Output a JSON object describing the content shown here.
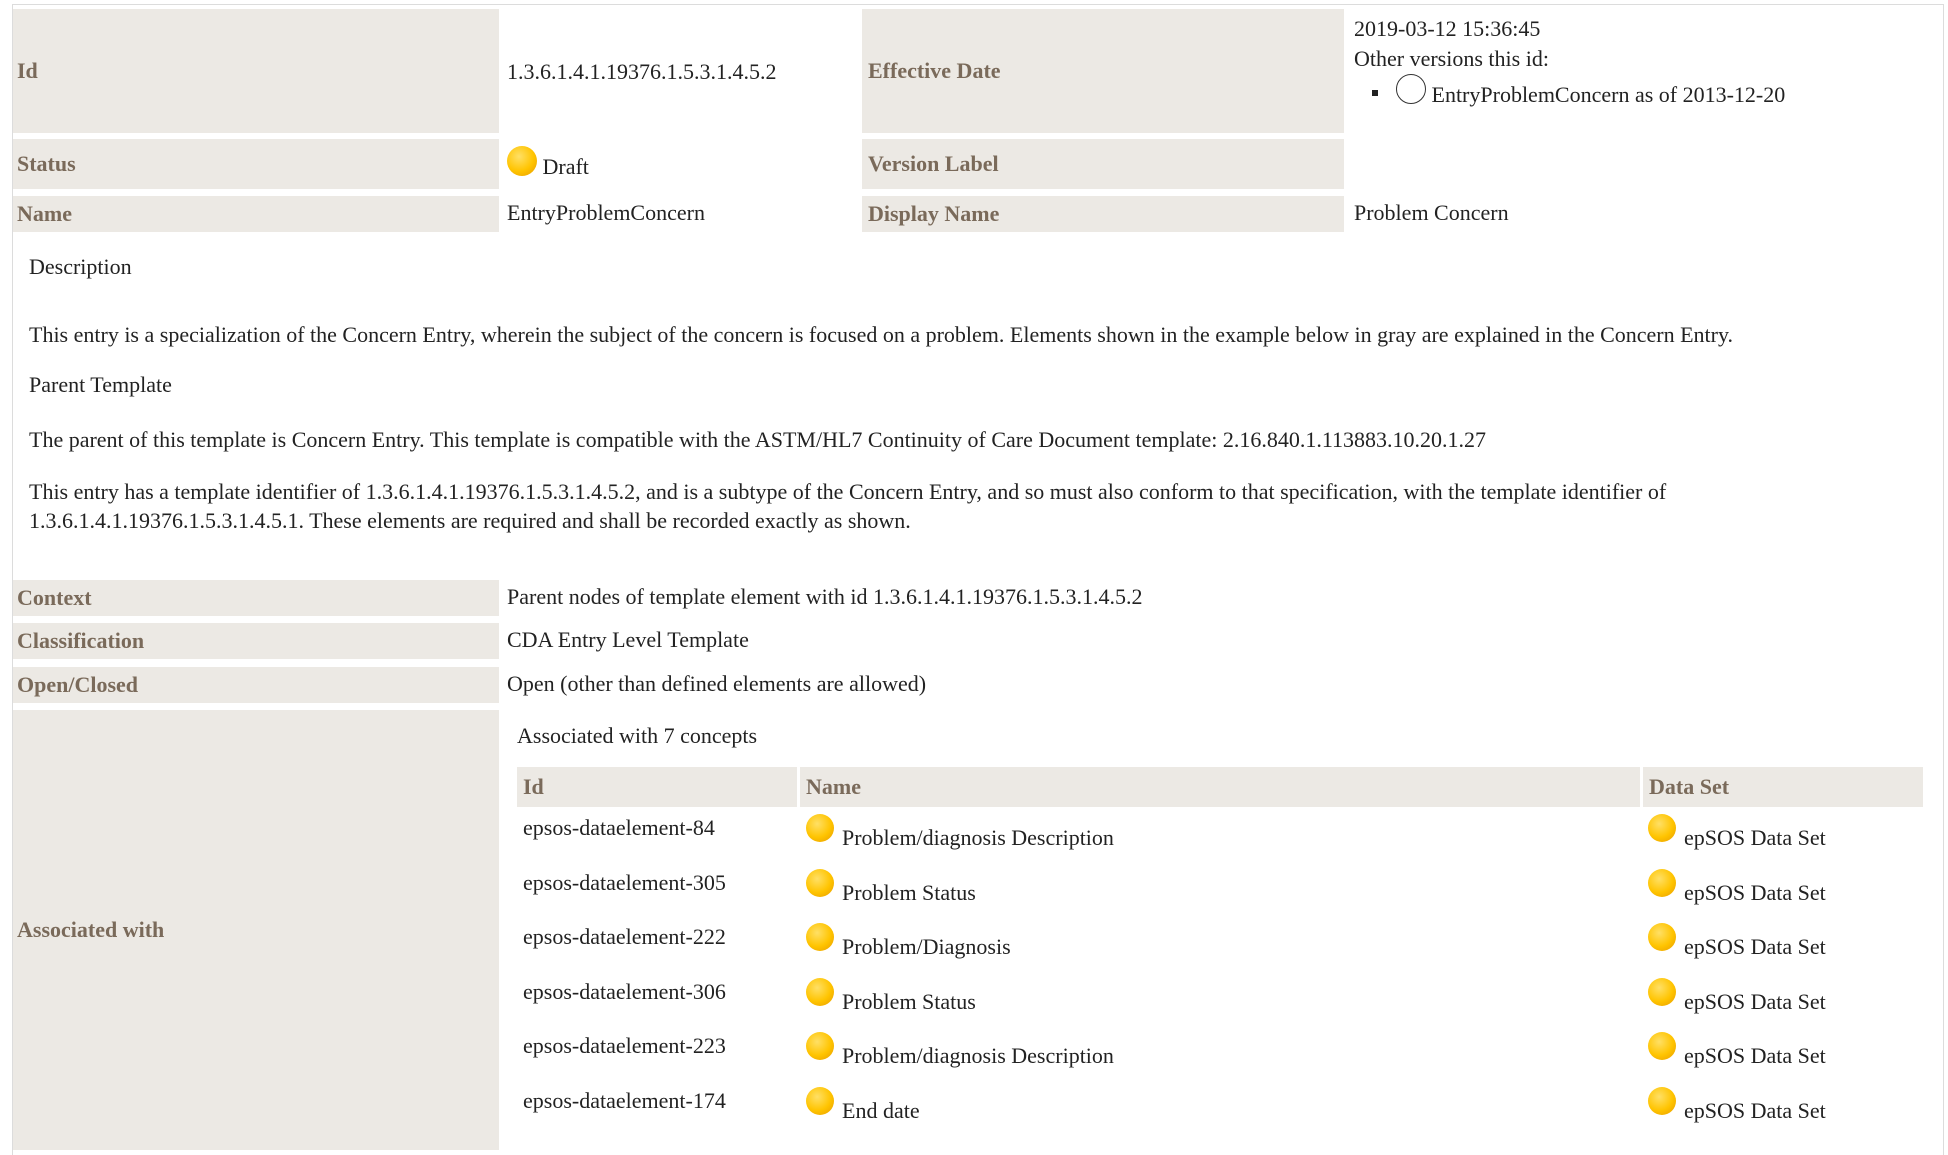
{
  "meta": {
    "id_label": "Id",
    "id_value": "1.3.6.1.4.1.19376.1.5.3.1.4.5.2",
    "effective_date_label": "Effective Date",
    "effective_date_value": "2019-03-12 15:36:45",
    "other_versions_label": "Other versions this id:",
    "other_version_item": "EntryProblemConcern as of 2013-12-20",
    "status_label": "Status",
    "status_value": "Draft",
    "version_label_label": "Version Label",
    "name_label": "Name",
    "name_value": "EntryProblemConcern",
    "display_name_label": "Display Name",
    "display_name_value": "Problem Concern"
  },
  "description": {
    "heading": "Description",
    "p1": "This entry is a specialization of the Concern Entry, wherein the subject of the concern is focused on a problem. Elements shown in the example below in gray are explained in the Concern Entry.",
    "parent_heading": "Parent Template",
    "p2": "The parent of this template is Concern Entry. This template is compatible with the ASTM/HL7 Continuity of Care Document template: 2.16.840.1.113883.10.20.1.27",
    "p3": "This entry has a template identifier of 1.3.6.1.4.1.19376.1.5.3.1.4.5.2, and is a subtype of the Concern Entry, and so must also conform to that specification, with the template identifier of 1.3.6.1.4.1.19376.1.5.3.1.4.5.1. These elements are required and shall be recorded exactly as shown."
  },
  "context": {
    "context_label": "Context",
    "context_value": "Parent nodes of template element with id 1.3.6.1.4.1.19376.1.5.3.1.4.5.2",
    "classification_label": "Classification",
    "classification_value": "CDA Entry Level Template",
    "open_closed_label": "Open/Closed",
    "open_closed_value": "Open (other than defined elements are allowed)",
    "associated_label": "Associated with",
    "associated_summary": "Associated with 7 concepts"
  },
  "concepts": {
    "headers": {
      "id": "Id",
      "name": "Name",
      "dataset": "Data Set"
    },
    "rows": [
      {
        "id": "epsos-dataelement-84",
        "name": "Problem/diagnosis Description",
        "dataset": "epSOS Data Set"
      },
      {
        "id": "epsos-dataelement-305",
        "name": "Problem Status",
        "dataset": "epSOS Data Set"
      },
      {
        "id": "epsos-dataelement-222",
        "name": "Problem/Diagnosis",
        "dataset": "epSOS Data Set"
      },
      {
        "id": "epsos-dataelement-306",
        "name": "Problem Status",
        "dataset": "epSOS Data Set"
      },
      {
        "id": "epsos-dataelement-223",
        "name": "Problem/diagnosis Description",
        "dataset": "epSOS Data Set"
      },
      {
        "id": "epsos-dataelement-174",
        "name": "End date",
        "dataset": "epSOS Data Set"
      }
    ]
  },
  "colors": {
    "label_bg": "#ece9e4",
    "label_text": "#7a6a5a",
    "status_draft": "#ffc400"
  },
  "icons": {
    "status": "status-draft-dot-icon",
    "version": "version-circle-icon"
  }
}
